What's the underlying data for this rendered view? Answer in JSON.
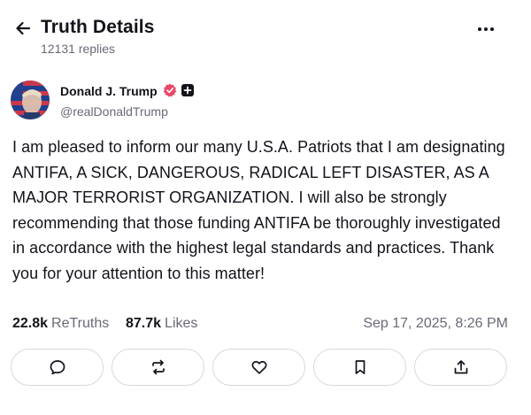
{
  "header": {
    "back_icon": "arrow-left-icon",
    "title": "Truth Details",
    "replies": "12131 replies",
    "more_icon": "more-horizontal-icon"
  },
  "author": {
    "name": "Donald J. Trump",
    "handle": "@realDonaldTrump",
    "verified_icon": "verified-badge-icon",
    "plus_icon": "plus-badge-icon",
    "verified_color": "#e9496b"
  },
  "post": {
    "text": "I am pleased to inform our many U.S.A. Patriots that I am designating ANTIFA, A SICK, DANGEROUS, RADICAL LEFT DISASTER, AS A MAJOR TERRORIST ORGANIZATION. I will also be strongly recommending that those funding ANTIFA be thoroughly investigated in accordance with the highest legal standards and practices. Thank you for your attention to this matter!"
  },
  "stats": {
    "retruths_count": "22.8k",
    "retruths_label": "ReTruths",
    "likes_count": "87.7k",
    "likes_label": "Likes",
    "timestamp": "Sep 17, 2025, 8:26 PM"
  },
  "actions": [
    {
      "icon": "reply-icon"
    },
    {
      "icon": "retruth-icon"
    },
    {
      "icon": "like-heart-icon"
    },
    {
      "icon": "bookmark-icon"
    },
    {
      "icon": "share-icon"
    }
  ]
}
